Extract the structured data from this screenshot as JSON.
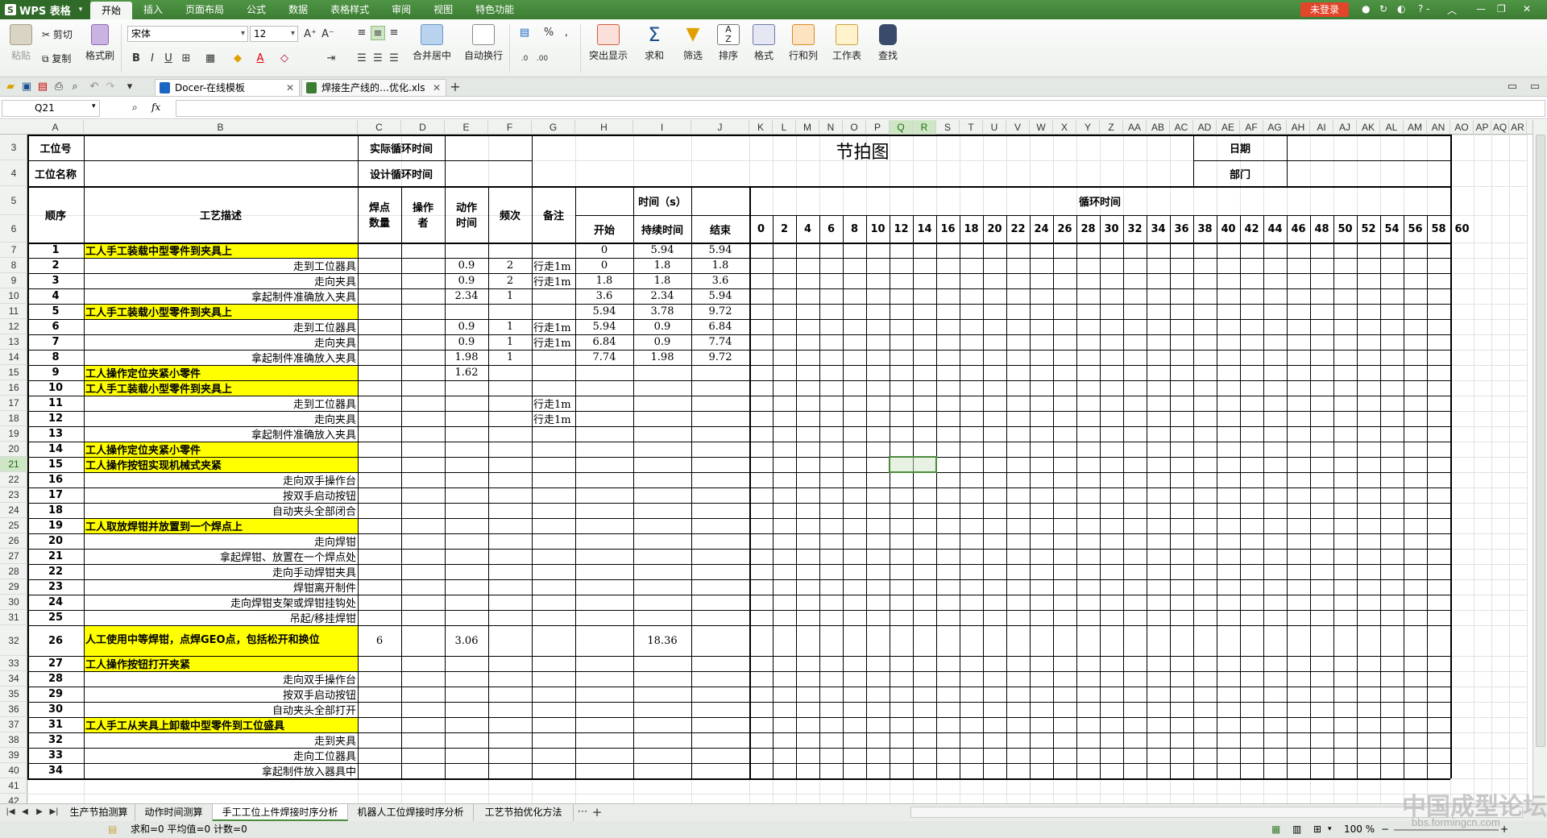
{
  "app": {
    "logo": "WPS 表格",
    "login": "未登录",
    "help": "? -"
  },
  "menu": [
    "开始",
    "插入",
    "页面布局",
    "公式",
    "数据",
    "表格样式",
    "审阅",
    "视图",
    "特色功能"
  ],
  "ribbon": {
    "paste": "粘贴",
    "cut": "剪切",
    "copy": "复制",
    "format_painter": "格式刷",
    "font_name": "宋体",
    "font_size": "12",
    "merge": "合并居中",
    "wrap": "自动换行",
    "cond_format": "突出显示",
    "sum": "求和",
    "filter": "筛选",
    "sort": "排序",
    "format": "格式",
    "rowcol": "行和列",
    "worksheet": "工作表",
    "find": "查找",
    "percent": "%",
    "comma": ","
  },
  "file_tabs": [
    {
      "label": "Docer-在线模板"
    },
    {
      "label": "焊接生产线的…优化.xls"
    }
  ],
  "formula": {
    "name_box": "Q21",
    "fx": "fx"
  },
  "columns": [
    "A",
    "B",
    "C",
    "D",
    "E",
    "F",
    "G",
    "H",
    "I",
    "J",
    "K",
    "L",
    "M",
    "N",
    "O",
    "P",
    "Q",
    "R",
    "S",
    "T",
    "U",
    "V",
    "W",
    "X",
    "Y",
    "Z",
    "AA",
    "AB",
    "AC",
    "AD",
    "AE",
    "AF",
    "AG",
    "AH",
    "AI",
    "AJ",
    "AK",
    "AL",
    "AM",
    "AN",
    "AO",
    "AP",
    "AQ",
    "AR"
  ],
  "rows": [
    "3",
    "4",
    "5",
    "6",
    "7",
    "8",
    "9",
    "10",
    "11",
    "12",
    "13",
    "14",
    "15",
    "16",
    "17",
    "18",
    "19",
    "20",
    "21",
    "22",
    "23",
    "24",
    "25",
    "26",
    "27",
    "28",
    "29",
    "30",
    "31",
    "32",
    "33",
    "34",
    "35",
    "36",
    "37",
    "38",
    "39",
    "40",
    "41",
    "42"
  ],
  "header": {
    "station_no": "工位号",
    "station_name": "工位名称",
    "actual_cycle": "实际循环时间",
    "design_cycle": "设计循环时间",
    "title": "节拍图",
    "date": "日期",
    "dept": "部门",
    "seq": "顺序",
    "process": "工艺描述",
    "weld_pts": "焊点数量",
    "operator": "操作者",
    "action_time": "动作时间",
    "freq": "频次",
    "note": "备注",
    "time_s": "时间（s）",
    "start": "开始",
    "duration": "持续时间",
    "end": "结束",
    "cycle_time": "循环时间",
    "ticks": [
      "0",
      "2",
      "4",
      "6",
      "8",
      "10",
      "12",
      "14",
      "16",
      "18",
      "20",
      "22",
      "24",
      "26",
      "28",
      "30",
      "32",
      "34",
      "36",
      "38",
      "40",
      "42",
      "44",
      "46",
      "48",
      "50",
      "52",
      "54",
      "56",
      "58",
      "60"
    ]
  },
  "table": [
    {
      "seq": "1",
      "desc": "工人手工装载中型零件到夹具上",
      "hl": true,
      "weld": "",
      "op": "",
      "act": "",
      "freq": "",
      "note": "",
      "start": "0",
      "dur": "5.94",
      "end": "5.94"
    },
    {
      "seq": "2",
      "desc": "走到工位器具",
      "hl": false,
      "weld": "",
      "op": "",
      "act": "0.9",
      "freq": "2",
      "note": "行走1m",
      "start": "0",
      "dur": "1.8",
      "end": "1.8"
    },
    {
      "seq": "3",
      "desc": "走向夹具",
      "hl": false,
      "weld": "",
      "op": "",
      "act": "0.9",
      "freq": "2",
      "note": "行走1m",
      "start": "1.8",
      "dur": "1.8",
      "end": "3.6"
    },
    {
      "seq": "4",
      "desc": "拿起制件准确放入夹具",
      "hl": false,
      "weld": "",
      "op": "",
      "act": "2.34",
      "freq": "1",
      "note": "",
      "start": "3.6",
      "dur": "2.34",
      "end": "5.94"
    },
    {
      "seq": "5",
      "desc": "工人手工装载小型零件到夹具上",
      "hl": true,
      "weld": "",
      "op": "",
      "act": "",
      "freq": "",
      "note": "",
      "start": "5.94",
      "dur": "3.78",
      "end": "9.72"
    },
    {
      "seq": "6",
      "desc": "走到工位器具",
      "hl": false,
      "weld": "",
      "op": "",
      "act": "0.9",
      "freq": "1",
      "note": "行走1m",
      "start": "5.94",
      "dur": "0.9",
      "end": "6.84"
    },
    {
      "seq": "7",
      "desc": "走向夹具",
      "hl": false,
      "weld": "",
      "op": "",
      "act": "0.9",
      "freq": "1",
      "note": "行走1m",
      "start": "6.84",
      "dur": "0.9",
      "end": "7.74"
    },
    {
      "seq": "8",
      "desc": "拿起制件准确放入夹具",
      "hl": false,
      "weld": "",
      "op": "",
      "act": "1.98",
      "freq": "1",
      "note": "",
      "start": "7.74",
      "dur": "1.98",
      "end": "9.72"
    },
    {
      "seq": "9",
      "desc": "工人操作定位夹紧小零件",
      "hl": true,
      "weld": "",
      "op": "",
      "act": "1.62",
      "freq": "",
      "note": "",
      "start": "",
      "dur": "",
      "end": ""
    },
    {
      "seq": "10",
      "desc": "工人手工装载小型零件到夹具上",
      "hl": true,
      "weld": "",
      "op": "",
      "act": "",
      "freq": "",
      "note": "",
      "start": "",
      "dur": "",
      "end": ""
    },
    {
      "seq": "11",
      "desc": "走到工位器具",
      "hl": false,
      "weld": "",
      "op": "",
      "act": "",
      "freq": "",
      "note": "行走1m",
      "start": "",
      "dur": "",
      "end": ""
    },
    {
      "seq": "12",
      "desc": "走向夹具",
      "hl": false,
      "weld": "",
      "op": "",
      "act": "",
      "freq": "",
      "note": "行走1m",
      "start": "",
      "dur": "",
      "end": ""
    },
    {
      "seq": "13",
      "desc": "拿起制件准确放入夹具",
      "hl": false,
      "weld": "",
      "op": "",
      "act": "",
      "freq": "",
      "note": "",
      "start": "",
      "dur": "",
      "end": ""
    },
    {
      "seq": "14",
      "desc": "工人操作定位夹紧小零件",
      "hl": true,
      "weld": "",
      "op": "",
      "act": "",
      "freq": "",
      "note": "",
      "start": "",
      "dur": "",
      "end": ""
    },
    {
      "seq": "15",
      "desc": "工人操作按钮实现机械式夹紧",
      "hl": true,
      "weld": "",
      "op": "",
      "act": "",
      "freq": "",
      "note": "",
      "start": "",
      "dur": "",
      "end": ""
    },
    {
      "seq": "16",
      "desc": "走向双手操作台",
      "hl": false,
      "weld": "",
      "op": "",
      "act": "",
      "freq": "",
      "note": "",
      "start": "",
      "dur": "",
      "end": ""
    },
    {
      "seq": "17",
      "desc": "按双手启动按钮",
      "hl": false,
      "weld": "",
      "op": "",
      "act": "",
      "freq": "",
      "note": "",
      "start": "",
      "dur": "",
      "end": ""
    },
    {
      "seq": "18",
      "desc": "自动夹头全部闭合",
      "hl": false,
      "weld": "",
      "op": "",
      "act": "",
      "freq": "",
      "note": "",
      "start": "",
      "dur": "",
      "end": ""
    },
    {
      "seq": "19",
      "desc": "工人取放焊钳并放置到一个焊点上",
      "hl": true,
      "weld": "",
      "op": "",
      "act": "",
      "freq": "",
      "note": "",
      "start": "",
      "dur": "",
      "end": ""
    },
    {
      "seq": "20",
      "desc": "走向焊钳",
      "hl": false,
      "weld": "",
      "op": "",
      "act": "",
      "freq": "",
      "note": "",
      "start": "",
      "dur": "",
      "end": ""
    },
    {
      "seq": "21",
      "desc": "拿起焊钳、放置在一个焊点处",
      "hl": false,
      "weld": "",
      "op": "",
      "act": "",
      "freq": "",
      "note": "",
      "start": "",
      "dur": "",
      "end": ""
    },
    {
      "seq": "22",
      "desc": "走向手动焊钳夹具",
      "hl": false,
      "weld": "",
      "op": "",
      "act": "",
      "freq": "",
      "note": "",
      "start": "",
      "dur": "",
      "end": ""
    },
    {
      "seq": "23",
      "desc": "焊钳离开制件",
      "hl": false,
      "weld": "",
      "op": "",
      "act": "",
      "freq": "",
      "note": "",
      "start": "",
      "dur": "",
      "end": ""
    },
    {
      "seq": "24",
      "desc": "走向焊钳支架或焊钳挂钩处",
      "hl": false,
      "weld": "",
      "op": "",
      "act": "",
      "freq": "",
      "note": "",
      "start": "",
      "dur": "",
      "end": ""
    },
    {
      "seq": "25",
      "desc": "吊起/移挂焊钳",
      "hl": false,
      "weld": "",
      "op": "",
      "act": "",
      "freq": "",
      "note": "",
      "start": "",
      "dur": "",
      "end": ""
    },
    {
      "seq": "26",
      "desc": "人工使用中等焊钳，点焊GEO点，包括松开和换位",
      "hl": true,
      "weld": "6",
      "op": "",
      "act": "3.06",
      "freq": "",
      "note": "",
      "start": "",
      "dur": "18.36",
      "end": ""
    },
    {
      "seq": "27",
      "desc": "工人操作按钮打开夹紧",
      "hl": true,
      "weld": "",
      "op": "",
      "act": "",
      "freq": "",
      "note": "",
      "start": "",
      "dur": "",
      "end": ""
    },
    {
      "seq": "28",
      "desc": "走向双手操作台",
      "hl": false,
      "weld": "",
      "op": "",
      "act": "",
      "freq": "",
      "note": "",
      "start": "",
      "dur": "",
      "end": ""
    },
    {
      "seq": "29",
      "desc": "按双手启动按钮",
      "hl": false,
      "weld": "",
      "op": "",
      "act": "",
      "freq": "",
      "note": "",
      "start": "",
      "dur": "",
      "end": ""
    },
    {
      "seq": "30",
      "desc": "自动夹头全部打开",
      "hl": false,
      "weld": "",
      "op": "",
      "act": "",
      "freq": "",
      "note": "",
      "start": "",
      "dur": "",
      "end": ""
    },
    {
      "seq": "31",
      "desc": "工人手工从夹具上卸载中型零件到工位盛具",
      "hl": true,
      "weld": "",
      "op": "",
      "act": "",
      "freq": "",
      "note": "",
      "start": "",
      "dur": "",
      "end": ""
    },
    {
      "seq": "32",
      "desc": "走到夹具",
      "hl": false,
      "weld": "",
      "op": "",
      "act": "",
      "freq": "",
      "note": "",
      "start": "",
      "dur": "",
      "end": ""
    },
    {
      "seq": "33",
      "desc": "走向工位器具",
      "hl": false,
      "weld": "",
      "op": "",
      "act": "",
      "freq": "",
      "note": "",
      "start": "",
      "dur": "",
      "end": ""
    },
    {
      "seq": "34",
      "desc": "拿起制件放入器具中",
      "hl": false,
      "weld": "",
      "op": "",
      "act": "",
      "freq": "",
      "note": "",
      "start": "",
      "dur": "",
      "end": ""
    }
  ],
  "sheets": [
    "生产节拍测算",
    "动作时间测算",
    "手工工位上件焊接时序分析",
    "机器人工位焊接时序分析",
    "工艺节拍优化方法"
  ],
  "active_sheet": 2,
  "status": {
    "summary": "求和=0  平均值=0  计数=0",
    "zoom": "100 %"
  },
  "watermark": {
    "text": "中国成型论坛",
    "url": "bbs.formingcn.com"
  },
  "colors": {
    "menubar": "#3c7d33",
    "highlight": "#ffff00",
    "selection": "#4b8b3b"
  }
}
